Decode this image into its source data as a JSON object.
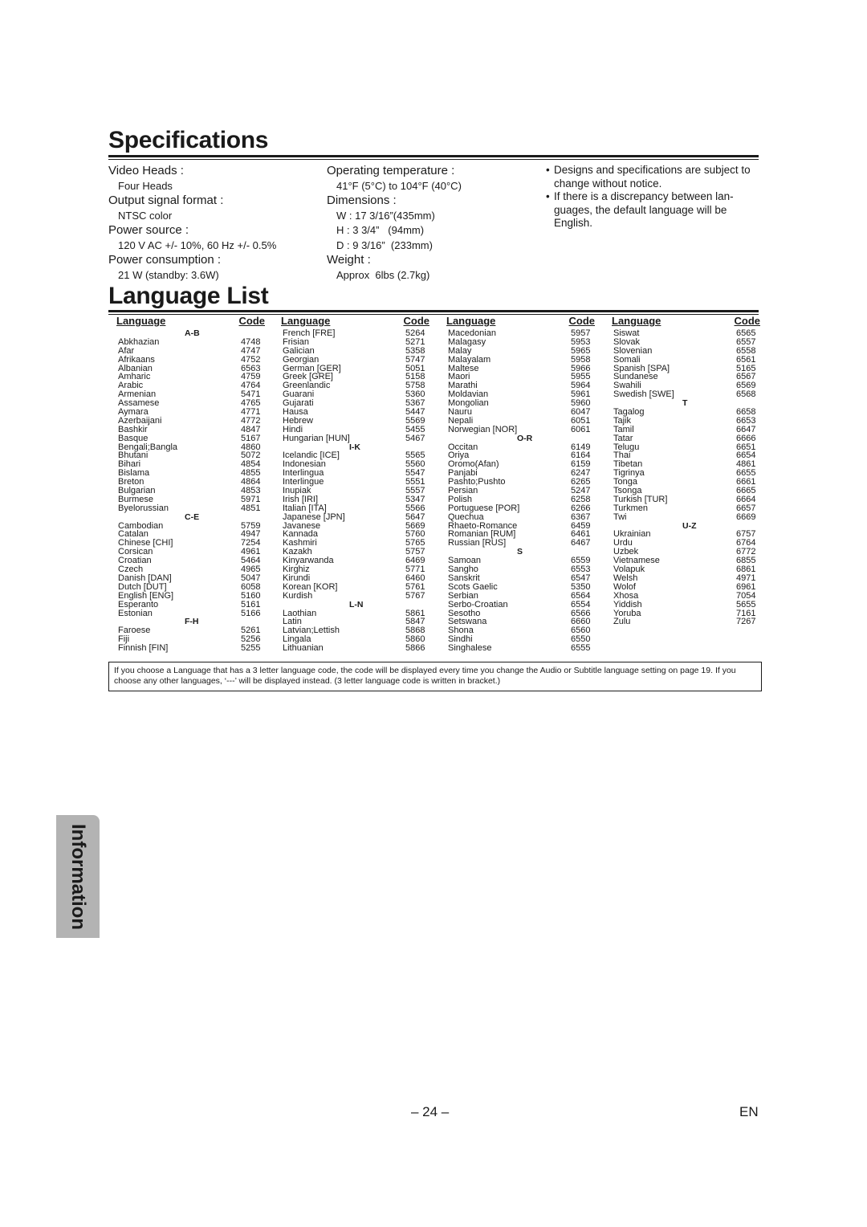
{
  "specifications": {
    "title": "Specifications",
    "column1": [
      {
        "label": "Video Heads :",
        "value": "Four Heads"
      },
      {
        "label": "Output signal format :",
        "value": "NTSC color"
      },
      {
        "label": "Power source :",
        "value": "120 V AC +/- 10%, 60 Hz +/- 0.5%"
      },
      {
        "label": "Power consumption :",
        "value": "21 W (standby: 3.6W)"
      }
    ],
    "column2": {
      "temperature": {
        "label": "Operating temperature :",
        "value": "41°F (5°C) to 104°F (40°C)"
      },
      "dimensions": {
        "label": "Dimensions :",
        "values": [
          "W : 17 3/16”(435mm)",
          "H : 3 3/4”   (94mm)",
          "D : 9 3/16”  (233mm)"
        ]
      },
      "weight": {
        "label": "Weight :",
        "value": "Approx  6lbs (2.7kg)"
      }
    },
    "notes": [
      "Designs and specifications are subject to change without notice.",
      "If there is a discrepancy between lan-guages, the default language will be English."
    ],
    "bullet": "•"
  },
  "language_list": {
    "title": "Language List",
    "header": {
      "language": "Language",
      "code": "Code"
    },
    "columns": [
      [
        {
          "section": "A-B"
        },
        {
          "name": "Abkhazian",
          "code": "4748"
        },
        {
          "name": "Afar",
          "code": "4747"
        },
        {
          "name": "Afrikaans",
          "code": "4752"
        },
        {
          "name": "Albanian",
          "code": "6563"
        },
        {
          "name": "Amharic",
          "code": "4759"
        },
        {
          "name": "Arabic",
          "code": "4764"
        },
        {
          "name": "Armenian",
          "code": "5471"
        },
        {
          "name": "Assamese",
          "code": "4765"
        },
        {
          "name": "Aymara",
          "code": "4771"
        },
        {
          "name": "Azerbaijani",
          "code": "4772"
        },
        {
          "name": "Bashkir",
          "code": "4847"
        },
        {
          "name": "Basque",
          "code": "5167"
        },
        {
          "name": "Bengali;Bangla",
          "code": "4860"
        },
        {
          "name": "Bhutani",
          "code": "5072"
        },
        {
          "name": "Bihari",
          "code": "4854"
        },
        {
          "name": "Bislama",
          "code": "4855"
        },
        {
          "name": "Breton",
          "code": "4864"
        },
        {
          "name": "Bulgarian",
          "code": "4853"
        },
        {
          "name": "Burmese",
          "code": "5971"
        },
        {
          "name": "Byelorussian",
          "code": "4851"
        },
        {
          "section": "C-E"
        },
        {
          "name": "Cambodian",
          "code": "5759"
        },
        {
          "name": "Catalan",
          "code": "4947"
        },
        {
          "name": "Chinese [CHI]",
          "code": "7254"
        },
        {
          "name": "Corsican",
          "code": "4961"
        },
        {
          "name": "Croatian",
          "code": "5464"
        },
        {
          "name": "Czech",
          "code": "4965"
        },
        {
          "name": "Danish [DAN]",
          "code": "5047"
        },
        {
          "name": "Dutch [DUT]",
          "code": "6058"
        },
        {
          "name": "English [ENG]",
          "code": "5160"
        },
        {
          "name": "Esperanto",
          "code": "5161"
        },
        {
          "name": "Estonian",
          "code": "5166"
        },
        {
          "section": "F-H"
        },
        {
          "name": "Faroese",
          "code": "5261"
        },
        {
          "name": "Fiji",
          "code": "5256"
        },
        {
          "name": "Finnish [FIN]",
          "code": "5255"
        }
      ],
      [
        {
          "name": "French [FRE]",
          "code": "5264"
        },
        {
          "name": "Frisian",
          "code": "5271"
        },
        {
          "name": "Galician",
          "code": "5358"
        },
        {
          "name": "Georgian",
          "code": "5747"
        },
        {
          "name": "German [GER]",
          "code": "5051"
        },
        {
          "name": "Greek [GRE]",
          "code": "5158"
        },
        {
          "name": "Greenlandic",
          "code": "5758"
        },
        {
          "name": "Guarani",
          "code": "5360"
        },
        {
          "name": "Gujarati",
          "code": "5367"
        },
        {
          "name": "Hausa",
          "code": "5447"
        },
        {
          "name": "Hebrew",
          "code": "5569"
        },
        {
          "name": "Hindi",
          "code": "5455"
        },
        {
          "name": "Hungarian [HUN]",
          "code": "5467"
        },
        {
          "section": "I-K"
        },
        {
          "name": "Icelandic [ICE]",
          "code": "5565"
        },
        {
          "name": "Indonesian",
          "code": "5560"
        },
        {
          "name": "Interlingua",
          "code": "5547"
        },
        {
          "name": "Interlingue",
          "code": "5551"
        },
        {
          "name": "Inupiak",
          "code": "5557"
        },
        {
          "name": "Irish [IRI]",
          "code": "5347"
        },
        {
          "name": "Italian [ITA]",
          "code": "5566"
        },
        {
          "name": "Japanese [JPN]",
          "code": "5647"
        },
        {
          "name": "Javanese",
          "code": "5669"
        },
        {
          "name": "Kannada",
          "code": "5760"
        },
        {
          "name": "Kashmiri",
          "code": "5765"
        },
        {
          "name": "Kazakh",
          "code": "5757"
        },
        {
          "name": "Kinyarwanda",
          "code": "6469"
        },
        {
          "name": "Kirghiz",
          "code": "5771"
        },
        {
          "name": "Kirundi",
          "code": "6460"
        },
        {
          "name": "Korean [KOR]",
          "code": "5761"
        },
        {
          "name": "Kurdish",
          "code": "5767"
        },
        {
          "section": "L-N"
        },
        {
          "name": "Laothian",
          "code": "5861"
        },
        {
          "name": "Latin",
          "code": "5847"
        },
        {
          "name": "Latvian;Lettish",
          "code": "5868"
        },
        {
          "name": "Lingala",
          "code": "5860"
        },
        {
          "name": "Lithuanian",
          "code": "5866"
        }
      ],
      [
        {
          "name": "Macedonian",
          "code": "5957"
        },
        {
          "name": "Malagasy",
          "code": "5953"
        },
        {
          "name": "Malay",
          "code": "5965"
        },
        {
          "name": "Malayalam",
          "code": "5958"
        },
        {
          "name": "Maltese",
          "code": "5966"
        },
        {
          "name": "Maori",
          "code": "5955"
        },
        {
          "name": "Marathi",
          "code": "5964"
        },
        {
          "name": "Moldavian",
          "code": "5961"
        },
        {
          "name": "Mongolian",
          "code": "5960"
        },
        {
          "name": "Nauru",
          "code": "6047"
        },
        {
          "name": "Nepali",
          "code": "6051"
        },
        {
          "name": "Norwegian [NOR]",
          "code": "6061"
        },
        {
          "section": "O-R"
        },
        {
          "name": "Occitan",
          "code": "6149"
        },
        {
          "name": "Oriya",
          "code": "6164"
        },
        {
          "name": "Oromo(Afan)",
          "code": "6159"
        },
        {
          "name": "Panjabi",
          "code": "6247"
        },
        {
          "name": "Pashto;Pushto",
          "code": "6265"
        },
        {
          "name": "Persian",
          "code": "5247"
        },
        {
          "name": "Polish",
          "code": "6258"
        },
        {
          "name": "Portuguese [POR]",
          "code": "6266"
        },
        {
          "name": "Quechua",
          "code": "6367"
        },
        {
          "name": "Rhaeto-Romance",
          "code": "6459"
        },
        {
          "name": "Romanian [RUM]",
          "code": "6461"
        },
        {
          "name": "Russian [RUS]",
          "code": "6467"
        },
        {
          "section": "S"
        },
        {
          "name": "Samoan",
          "code": "6559"
        },
        {
          "name": "Sangho",
          "code": "6553"
        },
        {
          "name": "Sanskrit",
          "code": "6547"
        },
        {
          "name": "Scots Gaelic",
          "code": "5350"
        },
        {
          "name": "Serbian",
          "code": "6564"
        },
        {
          "name": "Serbo-Croatian",
          "code": "6554"
        },
        {
          "name": "Sesotho",
          "code": "6566"
        },
        {
          "name": "Setswana",
          "code": "6660"
        },
        {
          "name": "Shona",
          "code": "6560"
        },
        {
          "name": "Sindhi",
          "code": "6550"
        },
        {
          "name": "Singhalese",
          "code": "6555"
        }
      ],
      [
        {
          "name": "Siswat",
          "code": "6565"
        },
        {
          "name": "Slovak",
          "code": "6557"
        },
        {
          "name": "Slovenian",
          "code": "6558"
        },
        {
          "name": "Somali",
          "code": "6561"
        },
        {
          "name": "Spanish [SPA]",
          "code": "5165"
        },
        {
          "name": "Sundanese",
          "code": "6567"
        },
        {
          "name": "Swahili",
          "code": "6569"
        },
        {
          "name": "Swedish [SWE]",
          "code": "6568"
        },
        {
          "section": "T"
        },
        {
          "name": "Tagalog",
          "code": "6658"
        },
        {
          "name": "Tajik",
          "code": "6653"
        },
        {
          "name": "Tamil",
          "code": "6647"
        },
        {
          "name": "Tatar",
          "code": "6666"
        },
        {
          "name": "Telugu",
          "code": "6651"
        },
        {
          "name": "Thai",
          "code": "6654"
        },
        {
          "name": "Tibetan",
          "code": "4861"
        },
        {
          "name": "Tigrinya",
          "code": "6655"
        },
        {
          "name": "Tonga",
          "code": "6661"
        },
        {
          "name": "Tsonga",
          "code": "6665"
        },
        {
          "name": "Turkish [TUR]",
          "code": "6664"
        },
        {
          "name": "Turkmen",
          "code": "6657"
        },
        {
          "name": "Twi",
          "code": "6669"
        },
        {
          "section": "U-Z"
        },
        {
          "name": "Ukrainian",
          "code": "6757"
        },
        {
          "name": "Urdu",
          "code": "6764"
        },
        {
          "name": "Uzbek",
          "code": "6772"
        },
        {
          "name": "Vietnamese",
          "code": "6855"
        },
        {
          "name": "Volapuk",
          "code": "6861"
        },
        {
          "name": "Welsh",
          "code": "4971"
        },
        {
          "name": "Wolof",
          "code": "6961"
        },
        {
          "name": "Xhosa",
          "code": "7054"
        },
        {
          "name": "Yiddish",
          "code": "5655"
        },
        {
          "name": "Yoruba",
          "code": "7161"
        },
        {
          "name": "Zulu",
          "code": "7267"
        }
      ]
    ],
    "note": "If you choose a Language that has a 3 letter language code, the code will be displayed every time you change the Audio or Subtitle language setting on page 19. If you choose any other languages, ‘---’ will be displayed instead. (3 letter language code is written in bracket.)"
  },
  "side_tab": {
    "label": "Information"
  },
  "footer": {
    "page_number": "– 24 –",
    "language": "EN"
  }
}
